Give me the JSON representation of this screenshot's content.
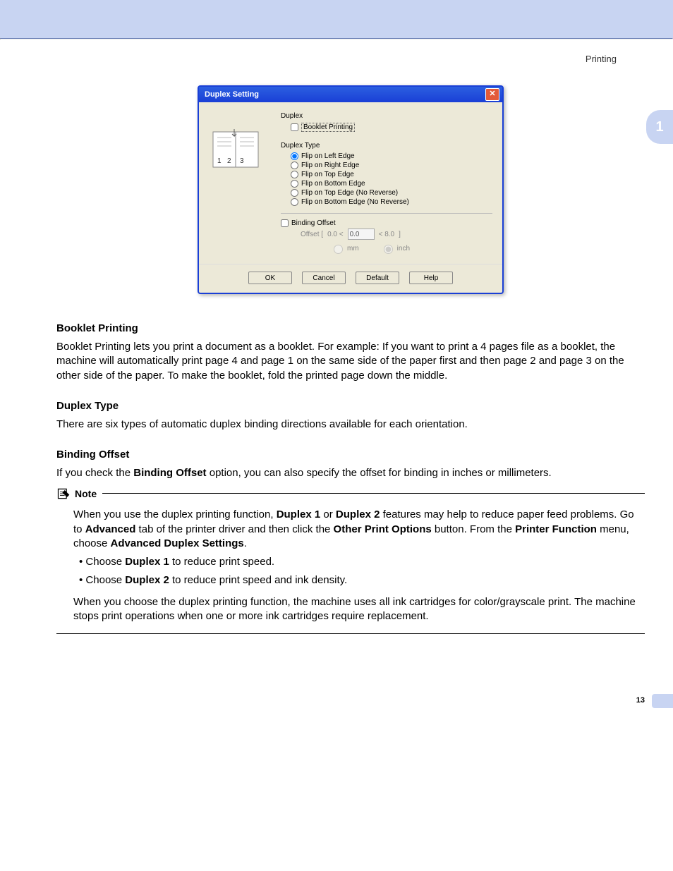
{
  "header": {
    "section": "Printing"
  },
  "side_tab": "1",
  "page_number": "13",
  "dialog": {
    "title": "Duplex Setting",
    "duplex": {
      "label": "Duplex",
      "booklet_checkbox": "Booklet Printing"
    },
    "duplex_type": {
      "label": "Duplex Type",
      "options": [
        "Flip on Left Edge",
        "Flip on Right Edge",
        "Flip on Top Edge",
        "Flip on Bottom Edge",
        "Flip on Top Edge (No Reverse)",
        "Flip on Bottom Edge (No Reverse)"
      ]
    },
    "binding_offset": {
      "checkbox": "Binding Offset",
      "offset_label": "Offset [",
      "min": "0.0 <",
      "value": "0.0",
      "max": "< 8.0",
      "bracket": "]",
      "unit_mm": "mm",
      "unit_inch": "inch"
    },
    "buttons": {
      "ok": "OK",
      "cancel": "Cancel",
      "default": "Default",
      "help": "Help"
    }
  },
  "sections": {
    "booklet": {
      "heading": "Booklet Printing",
      "body": "Booklet Printing lets you print a document as a booklet. For example: If you want to print a 4 pages file as a booklet, the machine will automatically print page 4 and page 1 on the same side of the paper first and then page 2 and page 3 on the other side of the paper. To make the booklet, fold the printed page down the middle."
    },
    "duplex_type": {
      "heading": "Duplex Type",
      "body": "There are six types of automatic duplex binding directions available for each orientation."
    },
    "binding_offset": {
      "heading": "Binding Offset",
      "body_pre": "If you check the ",
      "body_bold": "Binding Offset",
      "body_post": " option, you can also specify the offset for binding in inches or millimeters."
    }
  },
  "note": {
    "label": "Note",
    "para1": {
      "t1": "When you use the duplex printing function, ",
      "b1": "Duplex 1",
      "t2": " or ",
      "b2": "Duplex 2",
      "t3": " features may help to reduce paper feed problems. Go to ",
      "b3": "Advanced",
      "t4": " tab of the printer driver and then click the ",
      "b4": "Other Print Options",
      "t5": " button. From the ",
      "b5": "Printer Function",
      "t6": " menu, choose ",
      "b6": "Advanced Duplex Settings",
      "t7": "."
    },
    "bullet1": {
      "pre": "Choose ",
      "bold": "Duplex 1",
      "post": " to reduce print speed."
    },
    "bullet2": {
      "pre": "Choose ",
      "bold": "Duplex 2",
      "post": " to reduce print speed and ink density."
    },
    "para2": "When you choose the duplex printing function, the machine uses all ink cartridges for color/grayscale print. The machine stops print operations when one or more ink cartridges require replacement."
  }
}
